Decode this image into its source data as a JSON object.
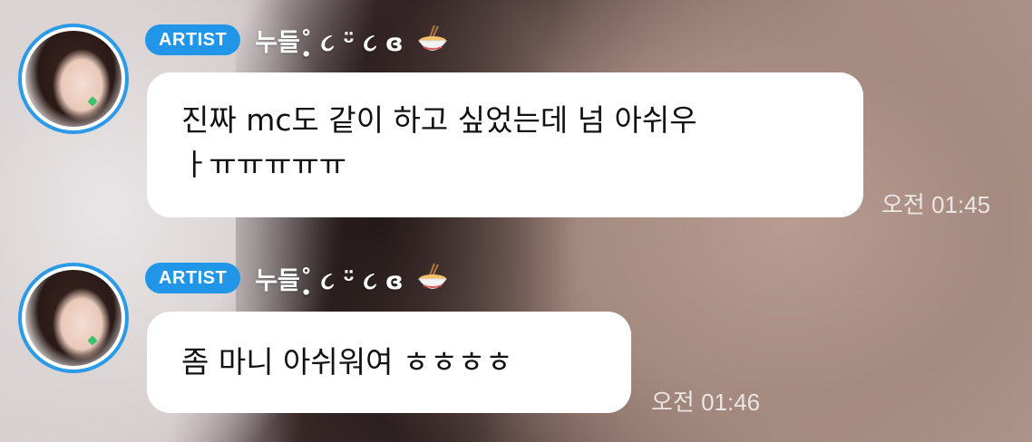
{
  "messages": [
    {
      "badge": "ARTIST",
      "nickname": "누들˚̩̥̩̥ ૮ ᵕ̈ ૮ ɞ",
      "avatar_icon": "profile-photo",
      "name_icon": "ramen-bowl-icon",
      "line1": "진짜 mc도 같이 하고 싶었는데 넘 아쉬우",
      "line2": "ㅏㅠㅠㅠㅠㅠ",
      "time": "오전 01:45"
    },
    {
      "badge": "ARTIST",
      "nickname": "누들˚̩̥̩̥ ૮ ᵕ̈ ૮ ɞ",
      "avatar_icon": "profile-photo",
      "name_icon": "ramen-bowl-icon",
      "line1": "좀 마니 아쉬워여 ㅎㅎㅎㅎ",
      "time": "오전 01:46"
    }
  ],
  "colors": {
    "badge": "#2196e8",
    "avatar_ring": "#2b9be8",
    "bubble": "#ffffff"
  }
}
